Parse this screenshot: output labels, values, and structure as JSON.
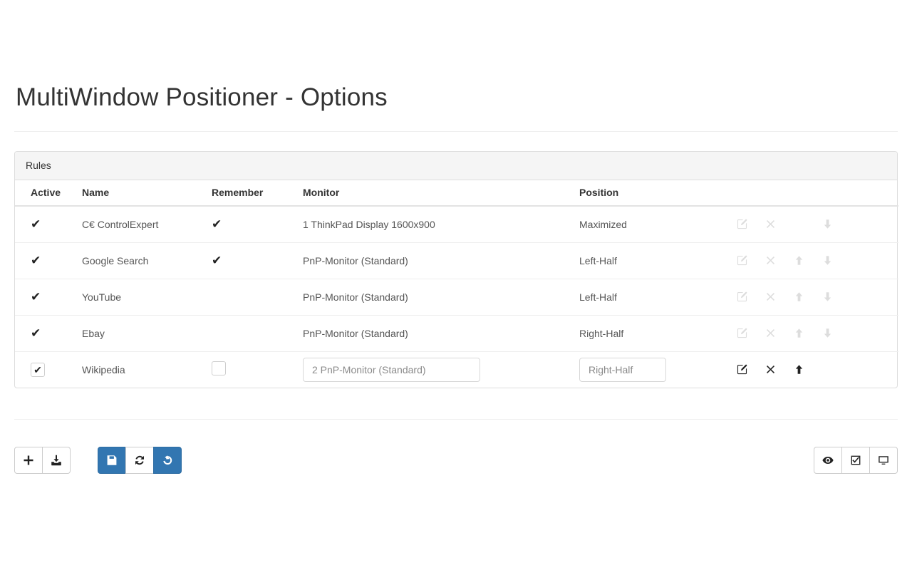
{
  "page": {
    "title": "MultiWindow Positioner - Options"
  },
  "panel": {
    "heading": "Rules"
  },
  "table": {
    "columns": [
      "Active",
      "Name",
      "Remember",
      "Monitor",
      "Position"
    ],
    "rows": [
      {
        "active": "✔",
        "name": "C€ ControlExpert",
        "remember": "✔",
        "monitor": "1 ThinkPad Display 1600x900",
        "position": "Maximized",
        "actions": [
          "edit-icon",
          "delete-icon",
          "move-down-icon"
        ],
        "state": "readonly"
      },
      {
        "active": "✔",
        "name": "Google Search",
        "remember": "✔",
        "monitor": "PnP-Monitor (Standard)",
        "position": "Left-Half",
        "actions": [
          "edit-icon",
          "delete-icon",
          "move-up-icon",
          "move-down-icon"
        ],
        "state": "readonly"
      },
      {
        "active": "✔",
        "name": "YouTube",
        "remember": "",
        "monitor": "PnP-Monitor (Standard)",
        "position": "Left-Half",
        "actions": [
          "edit-icon",
          "delete-icon",
          "move-up-icon",
          "move-down-icon"
        ],
        "state": "readonly"
      },
      {
        "active": "✔",
        "name": "Ebay",
        "remember": "",
        "monitor": "PnP-Monitor (Standard)",
        "position": "Right-Half",
        "actions": [
          "edit-icon",
          "delete-icon",
          "move-up-icon",
          "move-down-icon"
        ],
        "state": "readonly"
      },
      {
        "active": "✔",
        "name": "Wikipedia",
        "remember": "",
        "monitor": "2 PnP-Monitor (Standard)",
        "position": "Right-Half",
        "actions": [
          "edit-icon",
          "delete-icon",
          "move-up-icon"
        ],
        "state": "editing"
      }
    ]
  },
  "footer": {
    "left_group": [
      {
        "name": "add-rule-button",
        "icon": "plus-icon",
        "style": "default"
      },
      {
        "name": "import-rules-button",
        "icon": "import-icon",
        "style": "default"
      }
    ],
    "mid_group": [
      {
        "name": "save-button",
        "icon": "save-icon",
        "style": "primary"
      },
      {
        "name": "refresh-button",
        "icon": "refresh-icon",
        "style": "default"
      },
      {
        "name": "reset-button",
        "icon": "undo-icon",
        "style": "primary"
      }
    ],
    "right_group": [
      {
        "name": "preview-button",
        "icon": "eye-icon",
        "style": "default"
      },
      {
        "name": "select-all-button",
        "icon": "checkbox-checked-icon",
        "style": "default"
      },
      {
        "name": "monitors-button",
        "icon": "monitor-icon",
        "style": "default"
      }
    ]
  },
  "colors": {
    "primary": "#3276b1",
    "panel_border": "#dddddd",
    "heading_bg": "#f5f5f5",
    "text": "#333333",
    "muted_icon": "#dddddd"
  }
}
